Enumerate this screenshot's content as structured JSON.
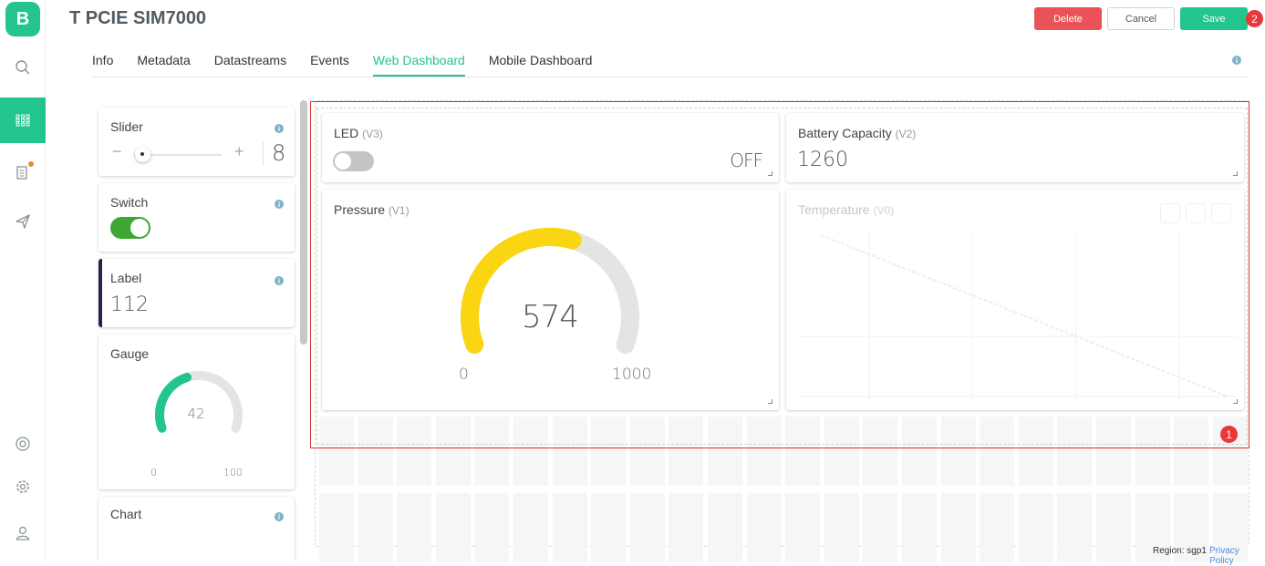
{
  "app": {
    "logo_letter": "B",
    "title": "T PCIE SIM7000"
  },
  "nav": [
    {
      "icon": "search-icon"
    },
    {
      "icon": "grid-icon",
      "active": true
    },
    {
      "icon": "document-icon",
      "notification": true
    },
    {
      "icon": "send-icon"
    },
    {
      "icon": "lifebuoy-icon"
    },
    {
      "icon": "gear-icon"
    },
    {
      "icon": "user-icon"
    }
  ],
  "header": {
    "delete_label": "Delete",
    "cancel_label": "Cancel",
    "save_label": "Save",
    "save_badge": "2",
    "selection_badge": "1"
  },
  "tabs": [
    {
      "label": "Info"
    },
    {
      "label": "Metadata"
    },
    {
      "label": "Datastreams"
    },
    {
      "label": "Events"
    },
    {
      "label": "Web Dashboard",
      "active": true
    },
    {
      "label": "Mobile Dashboard"
    }
  ],
  "palette": {
    "slider": {
      "name": "Slider",
      "minus": "−",
      "plus": "+",
      "value": "8"
    },
    "switch": {
      "name": "Switch",
      "on": true
    },
    "label": {
      "name": "Label",
      "value": "112"
    },
    "gauge": {
      "name": "Gauge",
      "value": "42",
      "min": "0",
      "max": "100",
      "fraction": 0.42
    },
    "chart": {
      "name": "Chart"
    }
  },
  "dashboard": {
    "led": {
      "title": "LED",
      "pin": "(V3)",
      "state": "OFF",
      "on": false
    },
    "battery": {
      "title": "Battery Capacity",
      "pin": "(V2)",
      "value": "1260"
    },
    "pressure": {
      "title": "Pressure",
      "pin": "(V1)",
      "value": "574",
      "min": "0",
      "max": "1000",
      "fraction": 0.574
    },
    "temperature": {
      "title": "Temperature",
      "pin": "(V0)"
    }
  },
  "footer": {
    "region": "Region: sgp1",
    "privacy": "Privacy Policy"
  },
  "colors": {
    "brand": "#23c48e",
    "danger": "#e95256",
    "gauge_yellow": "#f9d512",
    "gauge_track": "#e4e4e4"
  }
}
